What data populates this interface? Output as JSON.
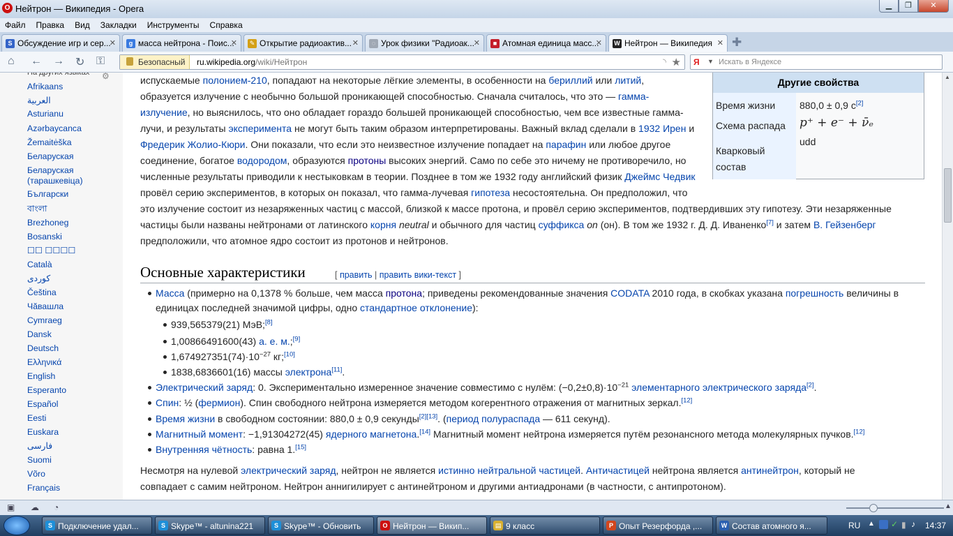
{
  "window": {
    "title": "Нейтрон — Википедия - Opera"
  },
  "menu": [
    "Файл",
    "Правка",
    "Вид",
    "Закладки",
    "Инструменты",
    "Справка"
  ],
  "tabs": [
    {
      "label": "Обсуждение игр и сер...",
      "icon_color": "#3464c8",
      "icon": "S"
    },
    {
      "label": "масса нейтрона - Поис...",
      "icon_color": "#3a7be0",
      "icon": "g"
    },
    {
      "label": "Открытие радиоактив...",
      "icon_color": "#d4a017",
      "icon": "✎"
    },
    {
      "label": "Урок физики \"Радиоак...",
      "icon_color": "#a0a8b4",
      "icon": "◌"
    },
    {
      "label": "Атомная единица масс...",
      "icon_color": "#c41e2a",
      "icon": "■"
    },
    {
      "label": "Нейтрон — Википедия",
      "icon_color": "#222222",
      "icon": "W"
    }
  ],
  "address": {
    "security": "Безопасный",
    "url_domain": "ru.wikipedia.org",
    "url_path": "/wiki/Нейтрон"
  },
  "search": {
    "engine": "Я",
    "placeholder": "Искать в Яндексе"
  },
  "sidebar": {
    "heading": "На других языках",
    "languages": [
      "Afrikaans",
      "العربية",
      "Asturianu",
      "Azərbaycanca",
      "Žemaitėška",
      "Беларуская",
      "Беларуская (тарашкевіца)",
      "Български",
      "বাংলা",
      "Brezhoneg",
      "Bosanski",
      "☐☐ ☐☐☐☐",
      "Català",
      "کوردی",
      "Čeština",
      "Чăвашла",
      "Cymraeg",
      "Dansk",
      "Deutsch",
      "Ελληνικά",
      "English",
      "Esperanto",
      "Español",
      "Eesti",
      "Euskara",
      "فارسی",
      "Suomi",
      "Võro",
      "Français"
    ]
  },
  "infobox": {
    "title": "Другие свойства",
    "rows": [
      {
        "key": "Время жизни",
        "value": "880,0 ± 0,9 с",
        "sup": "[2]"
      },
      {
        "key": "Схема распада",
        "value": "p⁺ + e⁻ + ν̄ₑ"
      },
      {
        "key": "Кварковый",
        "key2": "состав",
        "value": "udd"
      }
    ]
  },
  "paragraph1": [
    [
      {
        "t": "испускаемые "
      },
      {
        "t": "полонием-210",
        "a": 1
      },
      {
        "t": ", попадают на некоторые лёгкие элементы, в особенности на "
      },
      {
        "t": "бериллий",
        "a": 1
      },
      {
        "t": " или "
      },
      {
        "t": "литий",
        "a": 1
      },
      {
        "t": ","
      }
    ],
    [
      {
        "t": "образуется излучение с необычно большой проникающей способностью. Сначала считалось, что это — "
      },
      {
        "t": "гамма-",
        "a": 1
      }
    ],
    [
      {
        "t": "излучение",
        "a": 1
      },
      {
        "t": ", но выяснилось, что оно обладает гораздо большей проникающей способностью, чем все известные гамма-"
      }
    ],
    [
      {
        "t": "лучи, и результаты "
      },
      {
        "t": "эксперимента",
        "a": 1
      },
      {
        "t": " не могут быть таким образом интерпретированы. Важный вклад сделали в "
      },
      {
        "t": "1932",
        "a": 1
      },
      {
        "t": " "
      },
      {
        "t": "Ирен",
        "a": 1
      },
      {
        "t": " и"
      }
    ],
    [
      {
        "t": "Фредерик Жолио-Кюри",
        "a": 1
      },
      {
        "t": ". Они показали, что если это неизвестное излучение попадает на "
      },
      {
        "t": "парафин",
        "a": 1
      },
      {
        "t": " или любое другое"
      }
    ],
    [
      {
        "t": "соединение, богатое "
      },
      {
        "t": "водородом",
        "a": 1
      },
      {
        "t": ", образуются "
      },
      {
        "t": "протоны",
        "a": 2
      },
      {
        "t": " высоких энергий. Само по себе это ничему не противоречило, но"
      }
    ],
    [
      {
        "t": "численные результаты приводили к нестыковкам в теории. Позднее в том же 1932 году английский физик "
      },
      {
        "t": "Джеймс Чедвик",
        "a": 1
      }
    ],
    [
      {
        "t": "провёл серию экспериментов, в которых он показал, что гамма-лучевая "
      },
      {
        "t": "гипотеза",
        "a": 1
      },
      {
        "t": " несостоятельна. Он предположил, что"
      }
    ],
    [
      {
        "t": "это излучение состоит из незаряженных частиц с массой, близкой к массе протона, и провёл серию экспериментов, подтвердивших эту гипотезу. Эти незаряженные"
      }
    ],
    [
      {
        "t": "частицы были названы нейтронами от латинского "
      },
      {
        "t": "корня",
        "a": 1
      },
      {
        "t": " "
      },
      {
        "t": "neutral",
        "i": 1
      },
      {
        "t": " и обычного для частиц "
      },
      {
        "t": "суффикса",
        "a": 1
      },
      {
        "t": " "
      },
      {
        "t": "on",
        "i": 1
      },
      {
        "t": " (он). В том же 1932 г. Д. Д. Иваненко"
      },
      {
        "t": "[7]",
        "s": 1
      },
      {
        "t": " и затем "
      },
      {
        "t": "В. Гейзенберг",
        "a": 1
      }
    ],
    [
      {
        "t": "предположили, что атомное ядро состоит из протонов и нейтронов."
      }
    ]
  ],
  "section": {
    "title": "Основные характеристики",
    "edit_open": "[ ",
    "edit": "править",
    "sep": " | ",
    "edit_wiki": "править вики-текст",
    "edit_close": " ]"
  },
  "list": [
    [
      {
        "t": "Масса",
        "a": 1
      },
      {
        "t": " (примерно на 0,1378 % больше, чем масса "
      },
      {
        "t": "протона",
        "a": 2
      },
      {
        "t": "; приведены рекомендованные значения "
      },
      {
        "t": "CODATA",
        "a": 1
      },
      {
        "t": " 2010 года, в скобках указана "
      },
      {
        "t": "погрешность",
        "a": 1
      },
      {
        "t": " величины в"
      }
    ],
    [
      {
        "t": "единицах последней значимой цифры, одно "
      },
      {
        "t": "стандартное отклонение",
        "a": 1
      },
      {
        "t": "):"
      }
    ],
    [
      {
        "t": "939,565379(21) МэВ;"
      },
      {
        "t": "[8]",
        "s": 1
      }
    ],
    [
      {
        "t": "1,00866491600(43) "
      },
      {
        "t": "а. е. м.",
        "a": 1
      },
      {
        "t": ";"
      },
      {
        "t": "[9]",
        "s": 1
      }
    ],
    [
      {
        "t": "1,674927351(74)·10"
      },
      {
        "t": "−27",
        "s": 2
      },
      {
        "t": " кг;"
      },
      {
        "t": "[10]",
        "s": 1
      }
    ],
    [
      {
        "t": "1838,6836601(16) массы "
      },
      {
        "t": "электрона",
        "a": 1
      },
      {
        "t": "[11]",
        "s": 1
      },
      {
        "t": "."
      }
    ],
    [
      {
        "t": "Электрический заряд",
        "a": 1
      },
      {
        "t": ": 0. Экспериментально измеренное значение совместимо с нулём: (−0,2±0,8)·10"
      },
      {
        "t": "−21",
        "s": 2
      },
      {
        "t": " "
      },
      {
        "t": "элементарного электрического заряда",
        "a": 1
      },
      {
        "t": "[2]",
        "s": 1
      },
      {
        "t": "."
      }
    ],
    [
      {
        "t": "Спин",
        "a": 1
      },
      {
        "t": ": ½ ("
      },
      {
        "t": "фермион",
        "a": 1
      },
      {
        "t": "). Спин свободного нейтрона измеряется методом когерентного отражения от магнитных зеркал."
      },
      {
        "t": "[12]",
        "s": 1
      }
    ],
    [
      {
        "t": "Время жизни",
        "a": 1
      },
      {
        "t": " в свободном состоянии: 880,0 ± 0,9 секунды"
      },
      {
        "t": "[2][13]",
        "s": 1
      },
      {
        "t": ". ("
      },
      {
        "t": "период полураспада",
        "a": 1
      },
      {
        "t": " — 611 секунд)."
      }
    ],
    [
      {
        "t": "Магнитный момент",
        "a": 1
      },
      {
        "t": ": −1,91304272(45) "
      },
      {
        "t": "ядерного магнетона",
        "a": 1
      },
      {
        "t": "."
      },
      {
        "t": "[14]",
        "s": 1
      },
      {
        "t": " Магнитный момент нейтрона измеряется путём резонансного метода молекулярных пучков."
      },
      {
        "t": "[12]",
        "s": 1
      }
    ],
    [
      {
        "t": "Внутренняя чётность",
        "a": 1
      },
      {
        "t": ": равна 1."
      },
      {
        "t": "[15]",
        "s": 1
      }
    ]
  ],
  "paragraph2": [
    [
      {
        "t": "Несмотря на нулевой "
      },
      {
        "t": "электрический заряд",
        "a": 1
      },
      {
        "t": ", нейтрон не является "
      },
      {
        "t": "истинно нейтральной частицей",
        "a": 1
      },
      {
        "t": ". "
      },
      {
        "t": "Античастицей",
        "a": 1
      },
      {
        "t": " нейтрона является "
      },
      {
        "t": "антинейтрон",
        "a": 1
      },
      {
        "t": ", который не"
      }
    ],
    [
      {
        "t": "совпадает с самим нейтроном. Нейтрон аннигилирует с антинейтроном и другими антиадронами (в частности, с антипротоном)."
      }
    ]
  ],
  "taskbar": {
    "items": [
      {
        "label": "Подключение удал...",
        "icon_color": "#1e8fd8",
        "icon": "S"
      },
      {
        "label": "Skype™ - altunina221",
        "icon_color": "#1e8fd8",
        "icon": "S"
      },
      {
        "label": "Skype™ - Обновить",
        "icon_color": "#1e8fd8",
        "icon": "S"
      },
      {
        "label": "Нейтрон — Викип...",
        "icon_color": "#cc1010",
        "icon": "O"
      },
      {
        "label": "9 класс",
        "icon_color": "#d8b030",
        "icon": "▤"
      },
      {
        "label": "Опыт Резерфорда ,...",
        "icon_color": "#d2461e",
        "icon": "P"
      },
      {
        "label": "Состав атомного я...",
        "icon_color": "#2a5fb0",
        "icon": "W"
      }
    ],
    "lang": "RU",
    "time": "14:37"
  }
}
